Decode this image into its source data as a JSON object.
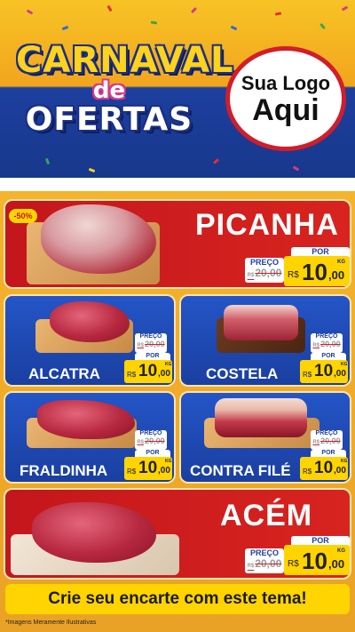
{
  "header": {
    "title_line1": "CARNAVAL",
    "title_de": "de",
    "title_line2": "OFERTAS",
    "logo_top": "Sua Logo",
    "logo_bottom": "Aqui"
  },
  "labels": {
    "old_label": "PREÇO",
    "new_label": "POR",
    "currency": "R$",
    "unit": "KG"
  },
  "discount_badge": "-50%",
  "products": [
    {
      "name": "PICANHA",
      "old_price": "20,00",
      "new_int": "10",
      "new_dec": ",00"
    },
    {
      "name": "ALCATRA",
      "old_price": "20,00",
      "new_int": "10",
      "new_dec": ",00"
    },
    {
      "name": "COSTELA",
      "old_price": "20,00",
      "new_int": "10",
      "new_dec": ",00"
    },
    {
      "name": "FRALDINHA",
      "old_price": "20,00",
      "new_int": "10",
      "new_dec": ",00"
    },
    {
      "name": "CONTRA FILÉ",
      "old_price": "20,00",
      "new_int": "10",
      "new_dec": ",00"
    },
    {
      "name": "ACÉM",
      "old_price": "20,00",
      "new_int": "10",
      "new_dec": ",00"
    }
  ],
  "footer": {
    "cta": "Crie seu encarte com este tema!",
    "disclaimer": "*Imagens Meramente Ilustrativas"
  },
  "colors": {
    "red": "#c4161c",
    "blue": "#1d3f9e",
    "yellow": "#ffd400",
    "orange": "#f2a51d"
  }
}
